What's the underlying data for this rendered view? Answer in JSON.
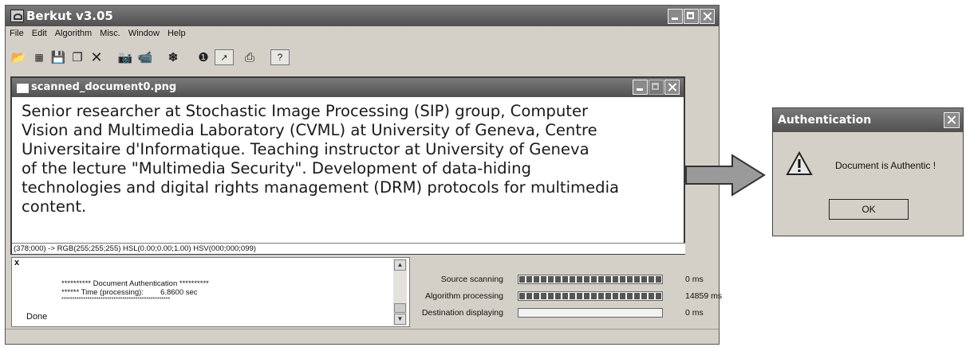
{
  "main_window": {
    "title": "Berkut v3.05",
    "menu": [
      "File",
      "Edit",
      "Algorithm",
      "Misc.",
      "Window",
      "Help"
    ],
    "toolbar_icons": [
      "open-folder-icon",
      "grid-icon",
      "save-icon",
      "stack-icon",
      "close-x-icon",
      "camera-icon",
      "video-camera-icon",
      "bluetooth-icon",
      "info-icon",
      "export-icon",
      "print-icon",
      "help-icon"
    ]
  },
  "document_window": {
    "title": "scanned_document0.png",
    "text_lines": [
      "Senior researcher at Stochastic Image Processing (SIP) group, Computer",
      "Vision and Multimedia Laboratory (CVML) at University of Geneva, Centre",
      "Universitaire d'Informatique. Teaching instructor at University of Geneva",
      "of the lecture \"Multimedia Security\". Development of data-hiding",
      "technologies and digital rights management (DRM) protocols for multimedia",
      "content."
    ],
    "pixel_status": "(378;000) -> RGB(255;255;255) HSL(0.00;0.00;1.00) HSV(000;000;099)"
  },
  "output": {
    "close_label": "x",
    "line1": "********** Document Authentication **********",
    "line2": "****** Time (processing):        6.8600 sec",
    "line3": "**************************************************",
    "line4": "Done"
  },
  "progress": [
    {
      "label": "Source scanning",
      "fill": 1.0,
      "time": "0 ms"
    },
    {
      "label": "Algorithm processing",
      "fill": 1.0,
      "time": "14859 ms"
    },
    {
      "label": "Destination displaying",
      "fill": 0.0,
      "time": "0 ms"
    }
  ],
  "auth_dialog": {
    "title": "Authentication",
    "message": "Document is Authentic !",
    "ok_label": "OK"
  }
}
